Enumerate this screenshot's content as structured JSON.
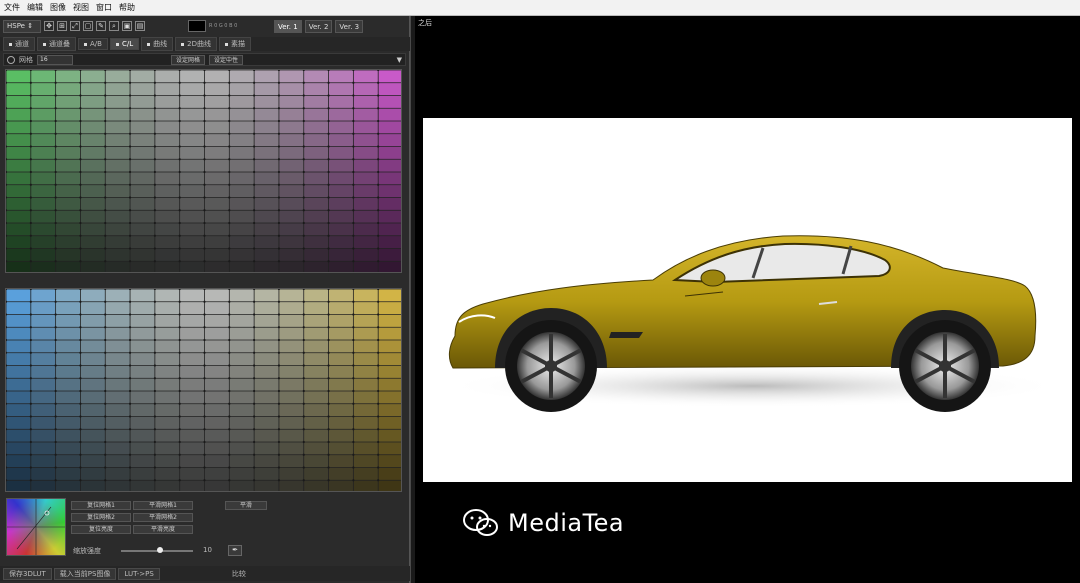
{
  "menu": [
    "文件",
    "编辑",
    "图像",
    "视图",
    "窗口",
    "帮助"
  ],
  "toolbar": {
    "mode": "HSPe",
    "rgb_readout": "R 0 G 0 B 0",
    "versions": [
      "Ver. 1",
      "Ver. 2",
      "Ver. 3"
    ],
    "active_version": "Ver. 1"
  },
  "tabs": [
    "通道",
    "通道叠",
    "A/B",
    "C/L",
    "曲线",
    "2D曲线",
    "素描"
  ],
  "active_tab": "C/L",
  "grid_bar": {
    "label": "网格",
    "value": "16",
    "btn_set_color": "设定网格",
    "btn_set_neutral": "设定中性"
  },
  "bottom_buttons": [
    "复位网格1",
    "平滑网格1",
    "复位网格2",
    "平滑网格2",
    "复位亮度",
    "平滑亮度"
  ],
  "smooth_btn": "平滑",
  "slider": {
    "label": "缩放强度",
    "value": "10"
  },
  "footer": {
    "save": "保存3DLUT",
    "load": "载入当前PS图像",
    "lut": "LUT->PS",
    "compare": "比较"
  },
  "preview": {
    "label": "之后"
  },
  "watermark": {
    "text": "MediaTea",
    "icon": "wechat-icon"
  },
  "colors": {
    "panel_bg": "#2b2b2b",
    "car_body": "#b59a12",
    "accent": "#cccccc"
  }
}
